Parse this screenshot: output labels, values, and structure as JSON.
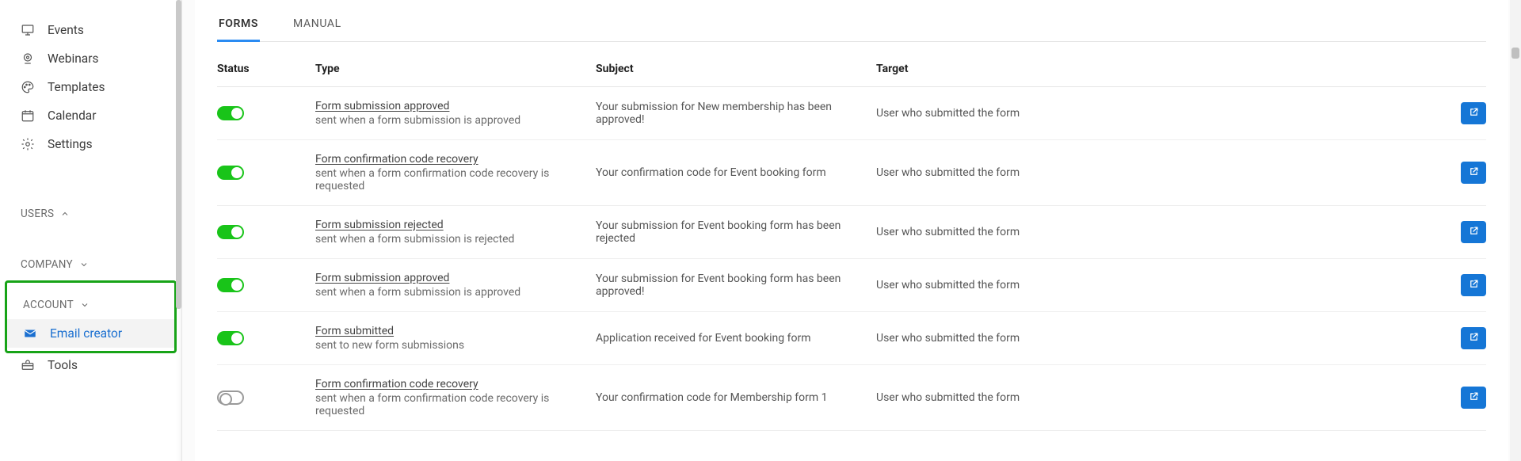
{
  "sidebar": {
    "items": [
      {
        "label": "Events"
      },
      {
        "label": "Webinars"
      },
      {
        "label": "Templates"
      },
      {
        "label": "Calendar"
      },
      {
        "label": "Settings"
      }
    ],
    "sections": {
      "users": "USERS",
      "company": "COMPANY",
      "account": "ACCOUNT"
    },
    "account_items": [
      {
        "label": "Email creator"
      },
      {
        "label": "Tools"
      }
    ]
  },
  "tabs": {
    "forms": "FORMS",
    "manual": "MANUAL"
  },
  "table": {
    "headers": {
      "status": "Status",
      "type": "Type",
      "subject": "Subject",
      "target": "Target"
    },
    "rows": [
      {
        "status": true,
        "type_title": "Form submission approved",
        "type_desc": "sent when a form submission is approved",
        "subject": "Your submission for New membership has been approved!",
        "target": "User who submitted the form"
      },
      {
        "status": true,
        "type_title": "Form confirmation code recovery",
        "type_desc": "sent when a form confirmation code recovery is requested",
        "subject": "Your confirmation code for Event booking form",
        "target": "User who submitted the form"
      },
      {
        "status": true,
        "type_title": "Form submission rejected",
        "type_desc": "sent when a form submission is rejected",
        "subject": "Your submission for Event booking form has been rejected",
        "target": "User who submitted the form"
      },
      {
        "status": true,
        "type_title": "Form submission approved",
        "type_desc": "sent when a form submission is approved",
        "subject": "Your submission for Event booking form has been approved!",
        "target": "User who submitted the form"
      },
      {
        "status": true,
        "type_title": "Form submitted",
        "type_desc": "sent to new form submissions",
        "subject": "Application received for Event booking form",
        "target": "User who submitted the form"
      },
      {
        "status": false,
        "type_title": "Form confirmation code recovery",
        "type_desc": "sent when a form confirmation code recovery is requested",
        "subject": "Your confirmation code for Membership form 1",
        "target": "User who submitted the form"
      }
    ]
  }
}
